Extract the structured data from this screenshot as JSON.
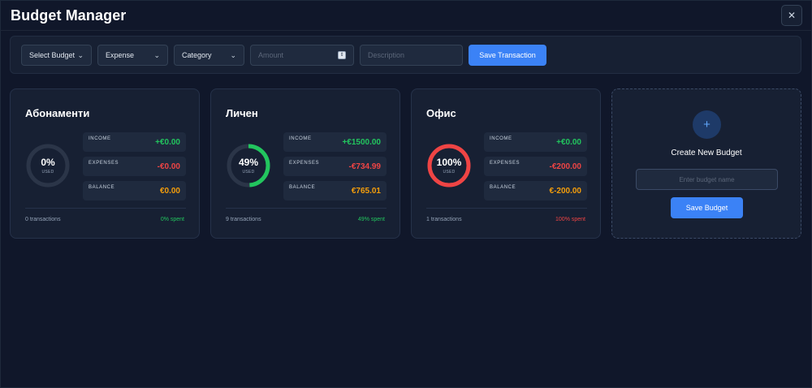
{
  "app": {
    "title": "Budget Manager",
    "close_icon": "close-icon"
  },
  "toolbar": {
    "budget_select": "Select Budget",
    "type_select": "Expense",
    "category_select": "Category",
    "amount_placeholder": "Amount",
    "description_placeholder": "Description",
    "save_label": "Save Transaction"
  },
  "colors": {
    "accent": "#3b82f6",
    "income": "#22c55e",
    "expenses": "#ef4444",
    "balance": "#f59e0b",
    "ring_track": "#2b3548"
  },
  "budgets": [
    {
      "name": "Абонаменти",
      "used_pct": "0%",
      "used_fraction": 0,
      "used_label": "USED",
      "ring_color": "#2b3548",
      "income_label": "INCOME",
      "income": "+€0.00",
      "expenses_label": "EXPENSES",
      "expenses": "-€0.00",
      "balance_label": "BALANCE",
      "balance": "€0.00",
      "transactions": "0 transactions",
      "spent": "0% spent",
      "spent_color": "#22c55e"
    },
    {
      "name": "Личен",
      "used_pct": "49%",
      "used_fraction": 0.49,
      "used_label": "USED",
      "ring_color": "#22c55e",
      "income_label": "INCOME",
      "income": "+€1500.00",
      "expenses_label": "EXPENSES",
      "expenses": "-€734.99",
      "balance_label": "BALANCE",
      "balance": "€765.01",
      "transactions": "9 transactions",
      "spent": "49% spent",
      "spent_color": "#22c55e"
    },
    {
      "name": "Офис",
      "used_pct": "100%",
      "used_fraction": 1.0,
      "used_label": "USED",
      "ring_color": "#ef4444",
      "income_label": "INCOME",
      "income": "+€0.00",
      "expenses_label": "EXPENSES",
      "expenses": "-€200.00",
      "balance_label": "BALANCE",
      "balance": "€-200.00",
      "transactions": "1 transactions",
      "spent": "100% spent",
      "spent_color": "#ef4444"
    }
  ],
  "new_budget": {
    "plus_icon": "plus-icon",
    "title": "Create New Budget",
    "input_placeholder": "Enter budget name",
    "save_label": "Save Budget"
  }
}
